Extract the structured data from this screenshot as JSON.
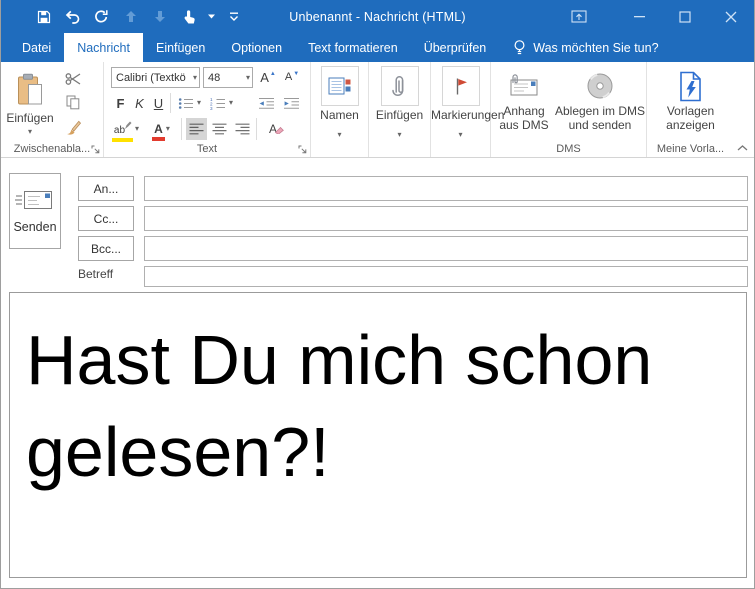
{
  "window": {
    "title": "Unbenannt  -  Nachricht (HTML)"
  },
  "tabs": {
    "file": "Datei",
    "message": "Nachricht",
    "insert": "Einfügen",
    "options": "Optionen",
    "format": "Text formatieren",
    "review": "Überprüfen",
    "tell_me": "Was möchten Sie tun?"
  },
  "ribbon": {
    "clipboard": {
      "paste": "Einfügen",
      "group": "Zwischenabla..."
    },
    "text": {
      "font_name": "Calibri (Textkö",
      "font_size": "48",
      "bold": "F",
      "italic": "K",
      "underline": "U",
      "grow": "A",
      "shrink": "A",
      "highlight": "ab",
      "font_color": "A",
      "clear": "A",
      "group": "Text"
    },
    "names": {
      "label": "Namen"
    },
    "include": {
      "label": "Einfügen"
    },
    "tags": {
      "label": "Markierungen"
    },
    "dms": {
      "attach_line1": "Anhang",
      "attach_line2": "aus DMS",
      "store_line1": "Ablegen im DMS",
      "store_line2": "und senden",
      "group": "DMS"
    },
    "templates": {
      "line1": "Vorlagen",
      "line2": "anzeigen",
      "group": "Meine Vorla..."
    }
  },
  "compose": {
    "send": "Senden",
    "to": "An...",
    "cc": "Cc...",
    "bcc": "Bcc...",
    "subject_label": "Betreff",
    "to_value": "",
    "cc_value": "",
    "bcc_value": "",
    "subject_value": "",
    "body": "Hast Du mich schon gelesen?!"
  },
  "colors": {
    "titlebar_blue": "#1f6cbd",
    "active_tab_text": "#1f6cbd",
    "flag_red": "#cf4a35",
    "bolt_blue": "#2f6fd0",
    "highlight_yellow": "#ffe100",
    "font_color_red": "#e23b2e",
    "accent_square_blue": "#4a7ebb"
  },
  "icons": {
    "save-icon": "floppy-disk",
    "undo-icon": "curved-arrow-left",
    "redo-icon": "circular-arrow",
    "previous-item-icon": "arrow-up-dim",
    "next-item-icon": "arrow-down-dim",
    "touch-mode-icon": "hand-pointer",
    "qat-customize-icon": "bar-chevron-down",
    "ribbon-display-icon": "window-arrow-up",
    "minimize-icon": "dash",
    "maximize-icon": "square",
    "close-icon": "x",
    "tell-me-icon": "lightbulb",
    "paste-icon": "clipboard-page",
    "cut-icon": "scissors",
    "copy-icon": "two-pages",
    "format-painter-icon": "brush",
    "bullets-icon": "bullet-list",
    "numbering-icon": "numbered-list",
    "grow-font-icon": "A-triangle-up",
    "shrink-font-icon": "A-triangle-down",
    "decrease-indent-icon": "lines-arrow-left",
    "increase-indent-icon": "lines-arrow-right",
    "highlight-icon": "ab-yellow-pen",
    "font-color-icon": "A-red-bar",
    "align-left-icon": "lines-left",
    "align-center-icon": "lines-center",
    "align-right-icon": "lines-right",
    "clear-format-icon": "A-eraser",
    "names-icon": "address-book",
    "attach-icon": "paperclip",
    "flag-icon": "red-flag",
    "dms-attach-icon": "envelope-paperclip",
    "dms-store-icon": "cd-disc",
    "templates-icon": "document-lightning",
    "send-icon": "envelope-speed",
    "dialog-launcher-icon": "corner-arrow",
    "collapse-ribbon-icon": "chevron-up"
  }
}
